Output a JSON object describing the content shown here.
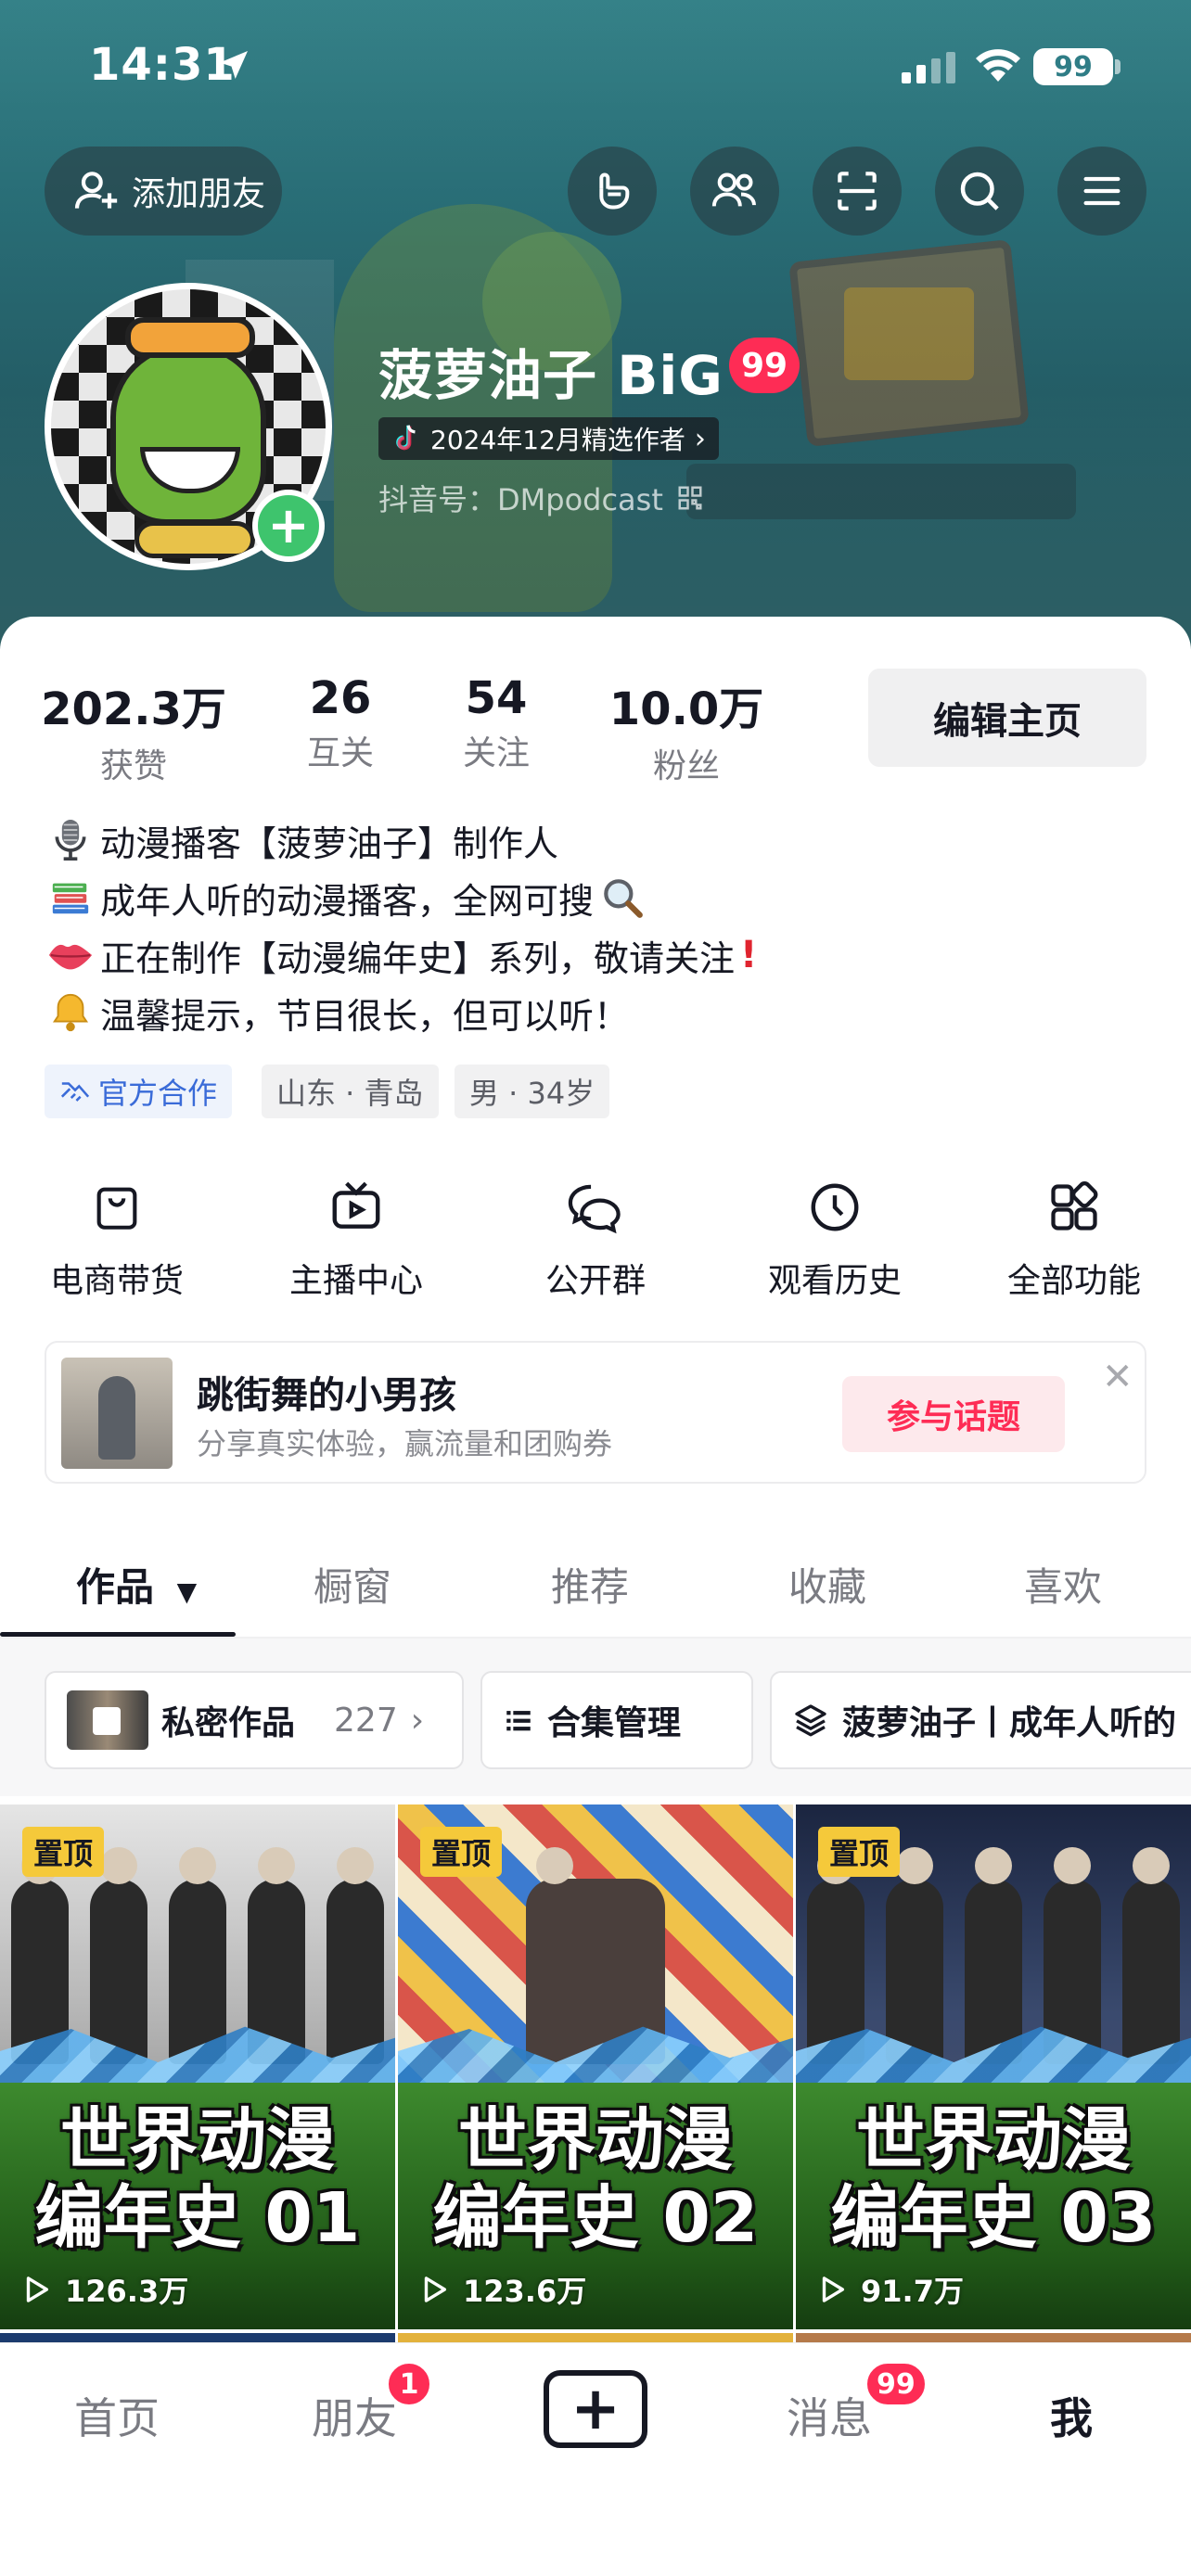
{
  "status_bar": {
    "time": "14:31",
    "battery": "99"
  },
  "header": {
    "add_friend_label": "添加朋友",
    "nickname": "菠萝油子 BiG",
    "nickname_badge": "99",
    "tag": "2024年12月精选作者",
    "douyin_id": "抖音号：DMpodcast"
  },
  "stats": [
    {
      "num": "202.3万",
      "label": "获赞"
    },
    {
      "num": "26",
      "label": "互关"
    },
    {
      "num": "54",
      "label": "关注"
    },
    {
      "num": "10.0万",
      "label": "粉丝"
    }
  ],
  "edit_profile_label": "编辑主页",
  "bio": [
    {
      "icon": "microphone-icon",
      "text": "动漫播客【菠萝油子】制作人"
    },
    {
      "icon": "books-icon",
      "text": "成年人听的动漫播客，全网可搜"
    },
    {
      "icon": "lips-icon",
      "text": "正在制作【动漫编年史】系列，敬请关注"
    },
    {
      "icon": "bell-icon",
      "text": "温馨提示，节目很长，但可以听！"
    }
  ],
  "chips": [
    "官方合作",
    "山东 · 青岛",
    "男 · 34岁"
  ],
  "functions": [
    {
      "icon": "shopping-bag-icon",
      "label": "电商带货"
    },
    {
      "icon": "tv-icon",
      "label": "主播中心"
    },
    {
      "icon": "chat-bubbles-icon",
      "label": "公开群"
    },
    {
      "icon": "clock-icon",
      "label": "观看历史"
    },
    {
      "icon": "grid-icon",
      "label": "全部功能"
    }
  ],
  "banner": {
    "title": "跳街舞的小男孩",
    "subtitle": "分享真实体验，赢流量和团购券",
    "button": "参与话题"
  },
  "tabs": [
    "作品",
    "橱窗",
    "推荐",
    "收藏",
    "喜欢"
  ],
  "folders": {
    "private_label": "私密作品",
    "private_count": "227",
    "collection_label": "合集管理",
    "series_label": "菠萝油子丨成年人听的"
  },
  "videos": [
    {
      "pin": "置顶",
      "title_line1": "世界动漫",
      "title_line2": "编年史 01",
      "plays": "126.3万"
    },
    {
      "pin": "置顶",
      "title_line1": "世界动漫",
      "title_line2": "编年史 02",
      "plays": "123.6万"
    },
    {
      "pin": "置顶",
      "title_line1": "世界动漫",
      "title_line2": "编年史 03",
      "plays": "91.7万"
    }
  ],
  "bottom_nav": {
    "home": "首页",
    "friends": "朋友",
    "friends_badge": "1",
    "messages": "消息",
    "messages_badge": "99",
    "me": "我"
  },
  "colors": {
    "accent": "#fe2c55",
    "header_teal": "#2f7d86",
    "pin_yellow": "#f5c93a"
  }
}
